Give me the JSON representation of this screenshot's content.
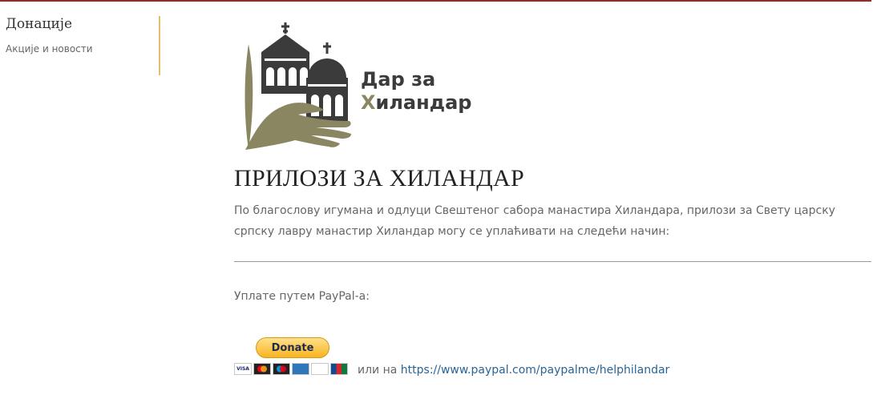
{
  "sidebar": {
    "title": "Донације",
    "link": "Акције и новости"
  },
  "logo": {
    "line1": "Дар за",
    "line2_accent": "Х",
    "line2_rest": "иландар"
  },
  "main": {
    "heading": "ПРИЛОЗИ ЗА ХИЛАНДАР",
    "intro": "По благослову игумана и одлуци Свештеног сабора манастира Хиландара, прилози за Свету царску српску лавру манастир Хиландар могу се уплаћивати на следећи начин:",
    "paypal_label": "Уплате путем PayPal-а:",
    "donate_label": "Donate",
    "or_text": "или на",
    "paypal_link": "https://www.paypal.com/paypalme/helphilandar"
  },
  "cards": [
    "VISA",
    "mastercard",
    "maestro",
    "AMEX",
    "DISCOVER",
    "JCB"
  ],
  "colors": {
    "top_rule": "#8f2f2a",
    "sidebar_rule": "#e2c16d",
    "logo_olive": "#8a8661",
    "logo_dark": "#3b3b3b",
    "link": "#2a6496"
  }
}
